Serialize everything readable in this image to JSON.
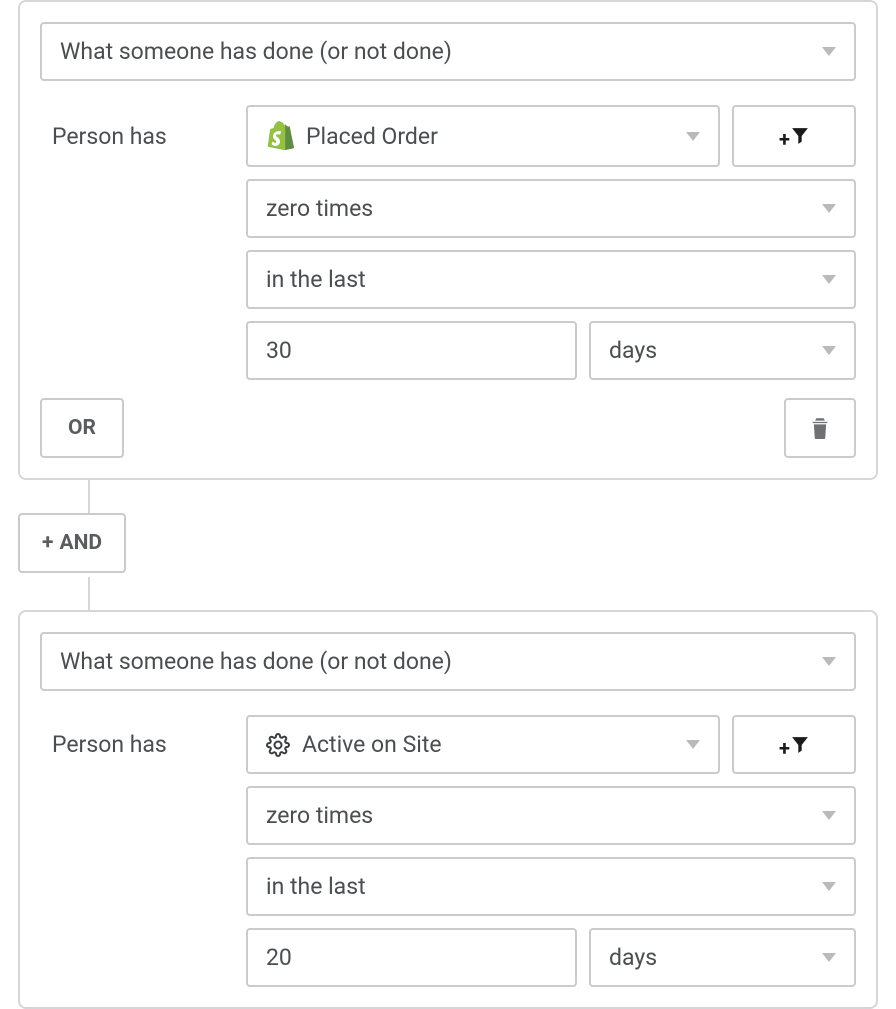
{
  "conditions": [
    {
      "type_label": "What someone has done (or not done)",
      "subject_label": "Person has",
      "metric_label": "Placed Order",
      "metric_icon": "shopify",
      "frequency_label": "zero times",
      "timeframe_label": "in the last",
      "amount_value": "30",
      "unit_label": "days"
    },
    {
      "type_label": "What someone has done (or not done)",
      "subject_label": "Person has",
      "metric_label": "Active on Site",
      "metric_icon": "gear",
      "frequency_label": "zero times",
      "timeframe_label": "in the last",
      "amount_value": "20",
      "unit_label": "days"
    }
  ],
  "buttons": {
    "or_label": "OR",
    "and_label": "AND"
  }
}
